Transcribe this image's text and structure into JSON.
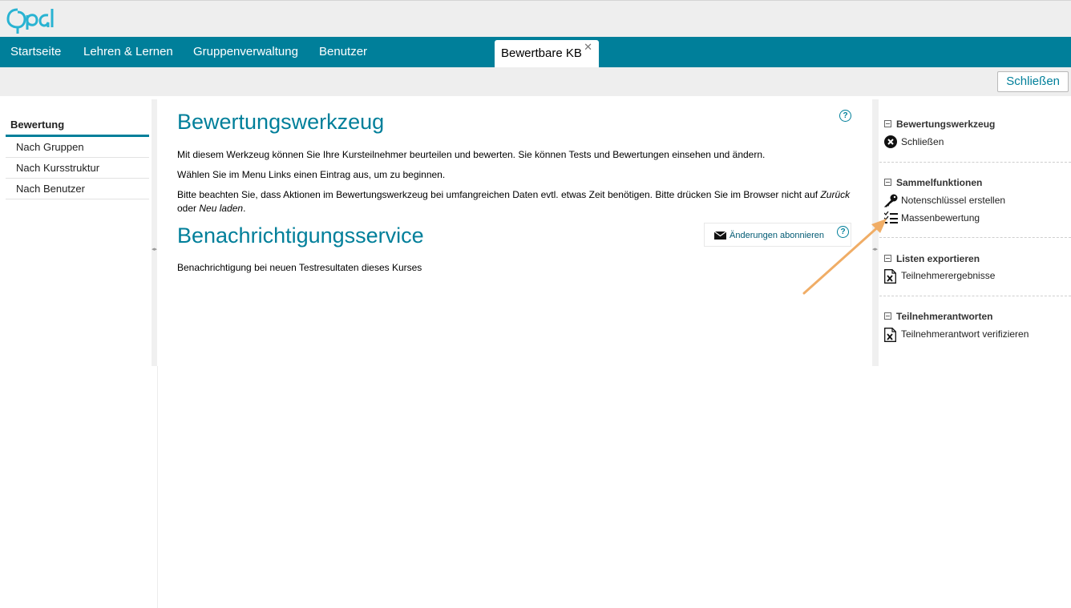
{
  "app": {
    "logo_text": "Opal",
    "brand_color": "#007f9a",
    "logo_color": "#29b3d2"
  },
  "nav": {
    "items": [
      {
        "label": "Startseite"
      },
      {
        "label": "Lehren & Lernen"
      },
      {
        "label": "Gruppenverwaltung"
      },
      {
        "label": "Benutzer"
      }
    ],
    "active_tab": {
      "label": "Bewertbare KB",
      "close_icon": "close-icon"
    }
  },
  "toolbar": {
    "close_label": "Schließen"
  },
  "left": {
    "heading": "Bewertung",
    "items": [
      {
        "label": "Nach Gruppen"
      },
      {
        "label": "Nach Kursstruktur"
      },
      {
        "label": "Nach Benutzer"
      }
    ]
  },
  "main": {
    "title": "Bewertungswerkzeug",
    "para1": "Mit diesem Werkzeug können Sie Ihre Kursteilnehmer beurteilen und bewerten. Sie können Tests und Bewertungen einsehen und ändern.",
    "para2": "Wählen Sie im Menu Links einen Eintrag aus, um zu beginnen.",
    "para3_a": "Bitte beachten Sie, dass Aktionen im Bewertungswerkzeug bei umfangreichen Daten evtl. etwas Zeit benötigen. Bitte drücken Sie im Browser nicht auf ",
    "para3_b": "Zurück",
    "para3_c": " oder ",
    "para3_d": "Neu laden",
    "para3_e": ".",
    "notif_title": "Benachrichtigungsservice",
    "subscribe_label": "Änderungen abonnieren",
    "notif_text": "Benachrichtigung bei neuen Testresultaten dieses Kurses",
    "help_glyph": "?"
  },
  "right": {
    "sections": [
      {
        "title": "Bewertungswerkzeug",
        "items": [
          {
            "label": "Schließen",
            "icon": "close-circle-icon"
          }
        ]
      },
      {
        "title": "Sammelfunktionen",
        "items": [
          {
            "label": "Notenschlüssel erstellen",
            "icon": "key-icon"
          },
          {
            "label": "Massenbewertung",
            "icon": "checklist-icon"
          }
        ]
      },
      {
        "title": "Listen exportieren",
        "items": [
          {
            "label": "Teilnehmerergebnisse",
            "icon": "excel-file-icon"
          }
        ]
      },
      {
        "title": "Teilnehmerantworten",
        "items": [
          {
            "label": "Teilnehmerantwort verifizieren",
            "icon": "excel-file-icon"
          }
        ]
      }
    ]
  },
  "annotation": {
    "arrow_color": "#f0ad66"
  }
}
